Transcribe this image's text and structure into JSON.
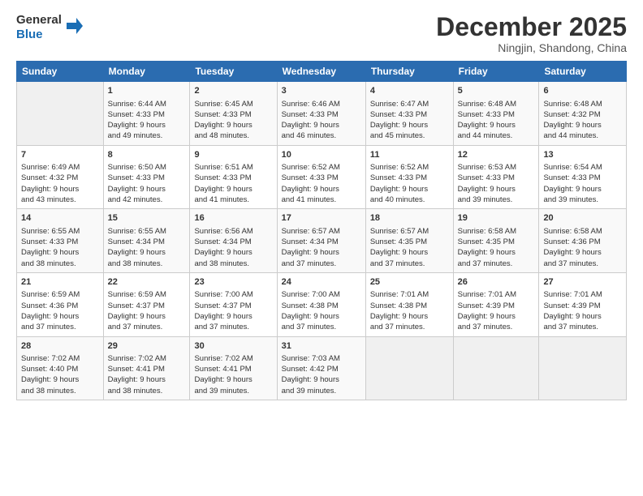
{
  "logo": {
    "line1": "General",
    "line2": "Blue"
  },
  "title": "December 2025",
  "subtitle": "Ningjin, Shandong, China",
  "weekdays": [
    "Sunday",
    "Monday",
    "Tuesday",
    "Wednesday",
    "Thursday",
    "Friday",
    "Saturday"
  ],
  "weeks": [
    [
      {
        "day": "",
        "info": ""
      },
      {
        "day": "1",
        "info": "Sunrise: 6:44 AM\nSunset: 4:33 PM\nDaylight: 9 hours\nand 49 minutes."
      },
      {
        "day": "2",
        "info": "Sunrise: 6:45 AM\nSunset: 4:33 PM\nDaylight: 9 hours\nand 48 minutes."
      },
      {
        "day": "3",
        "info": "Sunrise: 6:46 AM\nSunset: 4:33 PM\nDaylight: 9 hours\nand 46 minutes."
      },
      {
        "day": "4",
        "info": "Sunrise: 6:47 AM\nSunset: 4:33 PM\nDaylight: 9 hours\nand 45 minutes."
      },
      {
        "day": "5",
        "info": "Sunrise: 6:48 AM\nSunset: 4:33 PM\nDaylight: 9 hours\nand 44 minutes."
      },
      {
        "day": "6",
        "info": "Sunrise: 6:48 AM\nSunset: 4:32 PM\nDaylight: 9 hours\nand 44 minutes."
      }
    ],
    [
      {
        "day": "7",
        "info": "Sunrise: 6:49 AM\nSunset: 4:32 PM\nDaylight: 9 hours\nand 43 minutes."
      },
      {
        "day": "8",
        "info": "Sunrise: 6:50 AM\nSunset: 4:33 PM\nDaylight: 9 hours\nand 42 minutes."
      },
      {
        "day": "9",
        "info": "Sunrise: 6:51 AM\nSunset: 4:33 PM\nDaylight: 9 hours\nand 41 minutes."
      },
      {
        "day": "10",
        "info": "Sunrise: 6:52 AM\nSunset: 4:33 PM\nDaylight: 9 hours\nand 41 minutes."
      },
      {
        "day": "11",
        "info": "Sunrise: 6:52 AM\nSunset: 4:33 PM\nDaylight: 9 hours\nand 40 minutes."
      },
      {
        "day": "12",
        "info": "Sunrise: 6:53 AM\nSunset: 4:33 PM\nDaylight: 9 hours\nand 39 minutes."
      },
      {
        "day": "13",
        "info": "Sunrise: 6:54 AM\nSunset: 4:33 PM\nDaylight: 9 hours\nand 39 minutes."
      }
    ],
    [
      {
        "day": "14",
        "info": "Sunrise: 6:55 AM\nSunset: 4:33 PM\nDaylight: 9 hours\nand 38 minutes."
      },
      {
        "day": "15",
        "info": "Sunrise: 6:55 AM\nSunset: 4:34 PM\nDaylight: 9 hours\nand 38 minutes."
      },
      {
        "day": "16",
        "info": "Sunrise: 6:56 AM\nSunset: 4:34 PM\nDaylight: 9 hours\nand 38 minutes."
      },
      {
        "day": "17",
        "info": "Sunrise: 6:57 AM\nSunset: 4:34 PM\nDaylight: 9 hours\nand 37 minutes."
      },
      {
        "day": "18",
        "info": "Sunrise: 6:57 AM\nSunset: 4:35 PM\nDaylight: 9 hours\nand 37 minutes."
      },
      {
        "day": "19",
        "info": "Sunrise: 6:58 AM\nSunset: 4:35 PM\nDaylight: 9 hours\nand 37 minutes."
      },
      {
        "day": "20",
        "info": "Sunrise: 6:58 AM\nSunset: 4:36 PM\nDaylight: 9 hours\nand 37 minutes."
      }
    ],
    [
      {
        "day": "21",
        "info": "Sunrise: 6:59 AM\nSunset: 4:36 PM\nDaylight: 9 hours\nand 37 minutes."
      },
      {
        "day": "22",
        "info": "Sunrise: 6:59 AM\nSunset: 4:37 PM\nDaylight: 9 hours\nand 37 minutes."
      },
      {
        "day": "23",
        "info": "Sunrise: 7:00 AM\nSunset: 4:37 PM\nDaylight: 9 hours\nand 37 minutes."
      },
      {
        "day": "24",
        "info": "Sunrise: 7:00 AM\nSunset: 4:38 PM\nDaylight: 9 hours\nand 37 minutes."
      },
      {
        "day": "25",
        "info": "Sunrise: 7:01 AM\nSunset: 4:38 PM\nDaylight: 9 hours\nand 37 minutes."
      },
      {
        "day": "26",
        "info": "Sunrise: 7:01 AM\nSunset: 4:39 PM\nDaylight: 9 hours\nand 37 minutes."
      },
      {
        "day": "27",
        "info": "Sunrise: 7:01 AM\nSunset: 4:39 PM\nDaylight: 9 hours\nand 37 minutes."
      }
    ],
    [
      {
        "day": "28",
        "info": "Sunrise: 7:02 AM\nSunset: 4:40 PM\nDaylight: 9 hours\nand 38 minutes."
      },
      {
        "day": "29",
        "info": "Sunrise: 7:02 AM\nSunset: 4:41 PM\nDaylight: 9 hours\nand 38 minutes."
      },
      {
        "day": "30",
        "info": "Sunrise: 7:02 AM\nSunset: 4:41 PM\nDaylight: 9 hours\nand 39 minutes."
      },
      {
        "day": "31",
        "info": "Sunrise: 7:03 AM\nSunset: 4:42 PM\nDaylight: 9 hours\nand 39 minutes."
      },
      {
        "day": "",
        "info": ""
      },
      {
        "day": "",
        "info": ""
      },
      {
        "day": "",
        "info": ""
      }
    ]
  ]
}
